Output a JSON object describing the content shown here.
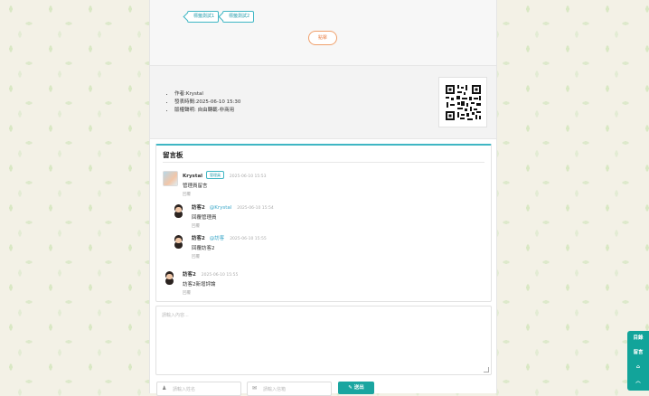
{
  "post": {
    "tags": [
      "標籤測試1",
      "標籤測試2"
    ],
    "pay_button": "點擊"
  },
  "info": {
    "author": "作者:Krystal",
    "published": "發表時間:2025-06-10 15:30",
    "license": "版權聲明: 自由轉載-非商用"
  },
  "board": {
    "title": "留言板",
    "comments": [
      {
        "name": "Krystal",
        "badge": "管理員",
        "at": "",
        "time": "2025-06-10 15:53",
        "text": "管理員留言",
        "reply": "回覆"
      },
      {
        "name": "訪客2",
        "badge": "",
        "at": "@Krystal",
        "time": "2025-06-10 15:54",
        "text": "回覆管理員",
        "reply": "回覆"
      },
      {
        "name": "訪客2",
        "badge": "",
        "at": "@訪客",
        "time": "2025-06-10 15:55",
        "text": "回覆訪客2",
        "reply": "回覆"
      },
      {
        "name": "訪客2",
        "badge": "",
        "at": "",
        "time": "2025-06-10 15:55",
        "text": "訪客2新增評論",
        "reply": "回覆"
      }
    ]
  },
  "form": {
    "content_placeholder": "請輸入內容...",
    "name_placeholder": "請輸入姓名",
    "email_placeholder": "請輸入信箱",
    "send_label": "送出"
  },
  "side": {
    "toc": "目錄",
    "comment": "留言",
    "github": "⌂",
    "top": "︿"
  },
  "colors": {
    "accent": "#3fb6c4",
    "button": "#1aa5a0",
    "pay": "#e9834b"
  }
}
